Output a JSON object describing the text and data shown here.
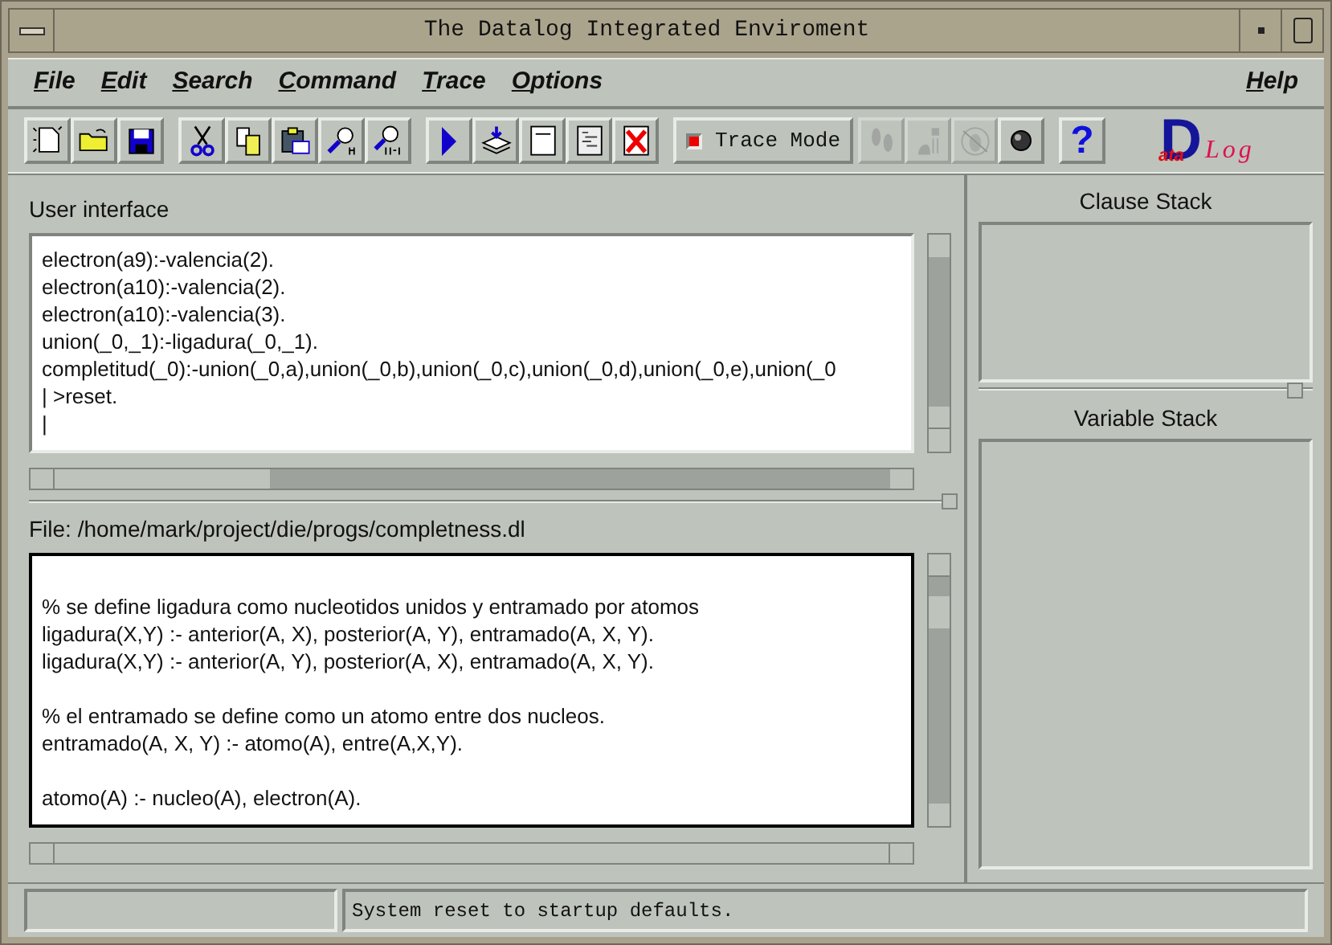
{
  "window": {
    "title": "The Datalog Integrated Enviroment"
  },
  "menu": [
    {
      "label": "File",
      "right": false
    },
    {
      "label": "Edit",
      "right": false
    },
    {
      "label": "Search",
      "right": false
    },
    {
      "label": "Command",
      "right": false
    },
    {
      "label": "Trace",
      "right": false
    },
    {
      "label": "Options",
      "right": false
    },
    {
      "label": "Help",
      "right": true
    }
  ],
  "toolbar": [
    {
      "kind": "icon",
      "disabled": false
    },
    {
      "kind": "icon",
      "disabled": false
    },
    {
      "kind": "icon",
      "disabled": false
    },
    {
      "kind": "gap"
    },
    {
      "kind": "icon",
      "disabled": false
    },
    {
      "kind": "icon",
      "disabled": false
    },
    {
      "kind": "icon",
      "disabled": false
    },
    {
      "kind": "icon",
      "disabled": false
    },
    {
      "kind": "icon",
      "disabled": false
    },
    {
      "kind": "gap"
    },
    {
      "kind": "icon",
      "disabled": false
    },
    {
      "kind": "icon",
      "disabled": false
    },
    {
      "kind": "icon",
      "disabled": false
    },
    {
      "kind": "icon",
      "disabled": false
    },
    {
      "kind": "icon",
      "disabled": false
    },
    {
      "kind": "gap"
    },
    {
      "kind": "toggle",
      "label": "Trace Mode",
      "on": true
    },
    {
      "kind": "icon",
      "disabled": true
    },
    {
      "kind": "icon",
      "disabled": true
    },
    {
      "kind": "icon",
      "disabled": true
    },
    {
      "kind": "icon",
      "disabled": false
    },
    {
      "kind": "gap"
    },
    {
      "kind": "text",
      "label": "?",
      "disabled": false
    }
  ],
  "logo": {
    "initial": "D",
    "upper": "ata",
    "lower": "Log"
  },
  "user_interface": {
    "label": "User interface",
    "lines": [
      "electron(a9):-valencia(2).",
      "electron(a10):-valencia(2).",
      "electron(a10):-valencia(3).",
      "union(_0,_1):-ligadura(_0,_1).",
      "completitud(_0):-union(_0,a),union(_0,b),union(_0,c),union(_0,d),union(_0,e),union(_0",
      "| >reset.",
      "|"
    ]
  },
  "file": {
    "label": "File: /home/mark/project/die/progs/completness.dl",
    "blocks": [
      [
        "% se define ligadura como nucleotidos unidos y entramado por atomos",
        "ligadura(X,Y) :- anterior(A, X), posterior(A, Y), entramado(A, X, Y).",
        "ligadura(X,Y) :- anterior(A, Y), posterior(A, X), entramado(A, X, Y)."
      ],
      [
        "% el entramado se define como un atomo entre dos nucleos.",
        "entramado(A, X, Y) :- atomo(A), entre(A,X,Y)."
      ],
      [
        "atomo(A) :- nucleo(A), electron(A)."
      ]
    ]
  },
  "clause_stack": {
    "label": "Clause Stack"
  },
  "variable_stack": {
    "label": "Variable Stack"
  },
  "status_bar": {
    "message": "System reset to startup defaults."
  }
}
